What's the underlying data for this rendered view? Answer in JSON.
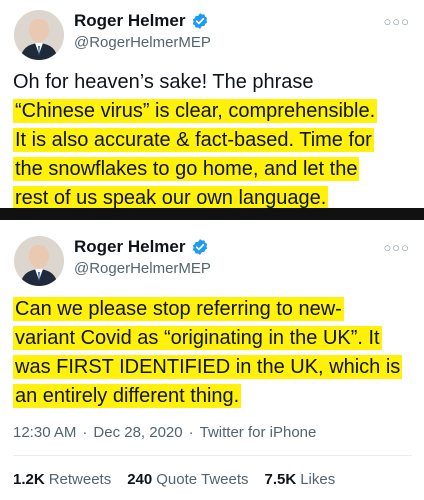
{
  "tweets": [
    {
      "display_name": "Roger Helmer",
      "handle": "@RogerHelmerMEP",
      "lines": [
        "Oh for heaven’s sake! The phrase",
        "“Chinese virus” is clear, comprehensible.",
        "It is also accurate & fact-based. Time for",
        "the snowflakes to go home, and let the",
        "rest of us speak our own language."
      ]
    },
    {
      "display_name": "Roger Helmer",
      "handle": "@RogerHelmerMEP",
      "lines": [
        "Can we please stop referring to new-",
        "variant Covid as “originating in the UK”. It",
        "was FIRST IDENTIFIED in the UK, which is",
        "an entirely different thing."
      ]
    }
  ],
  "meta": {
    "time": "12:30 AM",
    "date": "Dec 28, 2020",
    "source": "Twitter for iPhone"
  },
  "stats": {
    "retweets_count": "1.2K",
    "retweets_label": "Retweets",
    "quotes_count": "240",
    "quotes_label": "Quote Tweets",
    "likes_count": "7.5K",
    "likes_label": "Likes"
  },
  "colors": {
    "highlight": "#fff10a",
    "verified": "#1d9bf0",
    "secondary_text": "#536471"
  },
  "icons": [
    "avatar",
    "verified-badge-icon",
    "more-options-icon"
  ]
}
